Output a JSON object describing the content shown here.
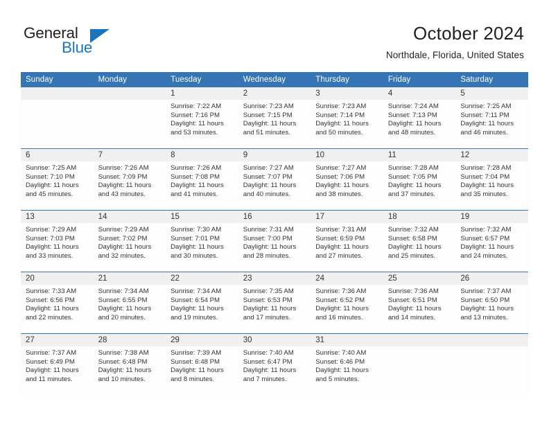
{
  "brand": {
    "name_part1": "General",
    "name_part2": "Blue",
    "logo_icon": "triangle-logo-icon",
    "accent_color": "#1b75bb"
  },
  "header": {
    "title": "October 2024",
    "subtitle": "Northdale, Florida, United States"
  },
  "theme": {
    "header_blue": "#3575b4",
    "daynum_band": "#f0f0f0",
    "cell_bg": "#fdfdfd",
    "text": "#333333"
  },
  "weekday_headers": [
    "Sunday",
    "Monday",
    "Tuesday",
    "Wednesday",
    "Thursday",
    "Friday",
    "Saturday"
  ],
  "weeks": [
    [
      {
        "day": "",
        "sunrise": "",
        "sunset": "",
        "daylight_line1": "",
        "daylight_line2": ""
      },
      {
        "day": "",
        "sunrise": "",
        "sunset": "",
        "daylight_line1": "",
        "daylight_line2": ""
      },
      {
        "day": "1",
        "sunrise": "Sunrise: 7:22 AM",
        "sunset": "Sunset: 7:16 PM",
        "daylight_line1": "Daylight: 11 hours",
        "daylight_line2": "and 53 minutes."
      },
      {
        "day": "2",
        "sunrise": "Sunrise: 7:23 AM",
        "sunset": "Sunset: 7:15 PM",
        "daylight_line1": "Daylight: 11 hours",
        "daylight_line2": "and 51 minutes."
      },
      {
        "day": "3",
        "sunrise": "Sunrise: 7:23 AM",
        "sunset": "Sunset: 7:14 PM",
        "daylight_line1": "Daylight: 11 hours",
        "daylight_line2": "and 50 minutes."
      },
      {
        "day": "4",
        "sunrise": "Sunrise: 7:24 AM",
        "sunset": "Sunset: 7:13 PM",
        "daylight_line1": "Daylight: 11 hours",
        "daylight_line2": "and 48 minutes."
      },
      {
        "day": "5",
        "sunrise": "Sunrise: 7:25 AM",
        "sunset": "Sunset: 7:11 PM",
        "daylight_line1": "Daylight: 11 hours",
        "daylight_line2": "and 46 minutes."
      }
    ],
    [
      {
        "day": "6",
        "sunrise": "Sunrise: 7:25 AM",
        "sunset": "Sunset: 7:10 PM",
        "daylight_line1": "Daylight: 11 hours",
        "daylight_line2": "and 45 minutes."
      },
      {
        "day": "7",
        "sunrise": "Sunrise: 7:26 AM",
        "sunset": "Sunset: 7:09 PM",
        "daylight_line1": "Daylight: 11 hours",
        "daylight_line2": "and 43 minutes."
      },
      {
        "day": "8",
        "sunrise": "Sunrise: 7:26 AM",
        "sunset": "Sunset: 7:08 PM",
        "daylight_line1": "Daylight: 11 hours",
        "daylight_line2": "and 41 minutes."
      },
      {
        "day": "9",
        "sunrise": "Sunrise: 7:27 AM",
        "sunset": "Sunset: 7:07 PM",
        "daylight_line1": "Daylight: 11 hours",
        "daylight_line2": "and 40 minutes."
      },
      {
        "day": "10",
        "sunrise": "Sunrise: 7:27 AM",
        "sunset": "Sunset: 7:06 PM",
        "daylight_line1": "Daylight: 11 hours",
        "daylight_line2": "and 38 minutes."
      },
      {
        "day": "11",
        "sunrise": "Sunrise: 7:28 AM",
        "sunset": "Sunset: 7:05 PM",
        "daylight_line1": "Daylight: 11 hours",
        "daylight_line2": "and 37 minutes."
      },
      {
        "day": "12",
        "sunrise": "Sunrise: 7:28 AM",
        "sunset": "Sunset: 7:04 PM",
        "daylight_line1": "Daylight: 11 hours",
        "daylight_line2": "and 35 minutes."
      }
    ],
    [
      {
        "day": "13",
        "sunrise": "Sunrise: 7:29 AM",
        "sunset": "Sunset: 7:03 PM",
        "daylight_line1": "Daylight: 11 hours",
        "daylight_line2": "and 33 minutes."
      },
      {
        "day": "14",
        "sunrise": "Sunrise: 7:29 AM",
        "sunset": "Sunset: 7:02 PM",
        "daylight_line1": "Daylight: 11 hours",
        "daylight_line2": "and 32 minutes."
      },
      {
        "day": "15",
        "sunrise": "Sunrise: 7:30 AM",
        "sunset": "Sunset: 7:01 PM",
        "daylight_line1": "Daylight: 11 hours",
        "daylight_line2": "and 30 minutes."
      },
      {
        "day": "16",
        "sunrise": "Sunrise: 7:31 AM",
        "sunset": "Sunset: 7:00 PM",
        "daylight_line1": "Daylight: 11 hours",
        "daylight_line2": "and 28 minutes."
      },
      {
        "day": "17",
        "sunrise": "Sunrise: 7:31 AM",
        "sunset": "Sunset: 6:59 PM",
        "daylight_line1": "Daylight: 11 hours",
        "daylight_line2": "and 27 minutes."
      },
      {
        "day": "18",
        "sunrise": "Sunrise: 7:32 AM",
        "sunset": "Sunset: 6:58 PM",
        "daylight_line1": "Daylight: 11 hours",
        "daylight_line2": "and 25 minutes."
      },
      {
        "day": "19",
        "sunrise": "Sunrise: 7:32 AM",
        "sunset": "Sunset: 6:57 PM",
        "daylight_line1": "Daylight: 11 hours",
        "daylight_line2": "and 24 minutes."
      }
    ],
    [
      {
        "day": "20",
        "sunrise": "Sunrise: 7:33 AM",
        "sunset": "Sunset: 6:56 PM",
        "daylight_line1": "Daylight: 11 hours",
        "daylight_line2": "and 22 minutes."
      },
      {
        "day": "21",
        "sunrise": "Sunrise: 7:34 AM",
        "sunset": "Sunset: 6:55 PM",
        "daylight_line1": "Daylight: 11 hours",
        "daylight_line2": "and 20 minutes."
      },
      {
        "day": "22",
        "sunrise": "Sunrise: 7:34 AM",
        "sunset": "Sunset: 6:54 PM",
        "daylight_line1": "Daylight: 11 hours",
        "daylight_line2": "and 19 minutes."
      },
      {
        "day": "23",
        "sunrise": "Sunrise: 7:35 AM",
        "sunset": "Sunset: 6:53 PM",
        "daylight_line1": "Daylight: 11 hours",
        "daylight_line2": "and 17 minutes."
      },
      {
        "day": "24",
        "sunrise": "Sunrise: 7:36 AM",
        "sunset": "Sunset: 6:52 PM",
        "daylight_line1": "Daylight: 11 hours",
        "daylight_line2": "and 16 minutes."
      },
      {
        "day": "25",
        "sunrise": "Sunrise: 7:36 AM",
        "sunset": "Sunset: 6:51 PM",
        "daylight_line1": "Daylight: 11 hours",
        "daylight_line2": "and 14 minutes."
      },
      {
        "day": "26",
        "sunrise": "Sunrise: 7:37 AM",
        "sunset": "Sunset: 6:50 PM",
        "daylight_line1": "Daylight: 11 hours",
        "daylight_line2": "and 13 minutes."
      }
    ],
    [
      {
        "day": "27",
        "sunrise": "Sunrise: 7:37 AM",
        "sunset": "Sunset: 6:49 PM",
        "daylight_line1": "Daylight: 11 hours",
        "daylight_line2": "and 11 minutes."
      },
      {
        "day": "28",
        "sunrise": "Sunrise: 7:38 AM",
        "sunset": "Sunset: 6:48 PM",
        "daylight_line1": "Daylight: 11 hours",
        "daylight_line2": "and 10 minutes."
      },
      {
        "day": "29",
        "sunrise": "Sunrise: 7:39 AM",
        "sunset": "Sunset: 6:48 PM",
        "daylight_line1": "Daylight: 11 hours",
        "daylight_line2": "and 8 minutes."
      },
      {
        "day": "30",
        "sunrise": "Sunrise: 7:40 AM",
        "sunset": "Sunset: 6:47 PM",
        "daylight_line1": "Daylight: 11 hours",
        "daylight_line2": "and 7 minutes."
      },
      {
        "day": "31",
        "sunrise": "Sunrise: 7:40 AM",
        "sunset": "Sunset: 6:46 PM",
        "daylight_line1": "Daylight: 11 hours",
        "daylight_line2": "and 5 minutes."
      },
      {
        "day": "",
        "sunrise": "",
        "sunset": "",
        "daylight_line1": "",
        "daylight_line2": ""
      },
      {
        "day": "",
        "sunrise": "",
        "sunset": "",
        "daylight_line1": "",
        "daylight_line2": ""
      }
    ]
  ]
}
